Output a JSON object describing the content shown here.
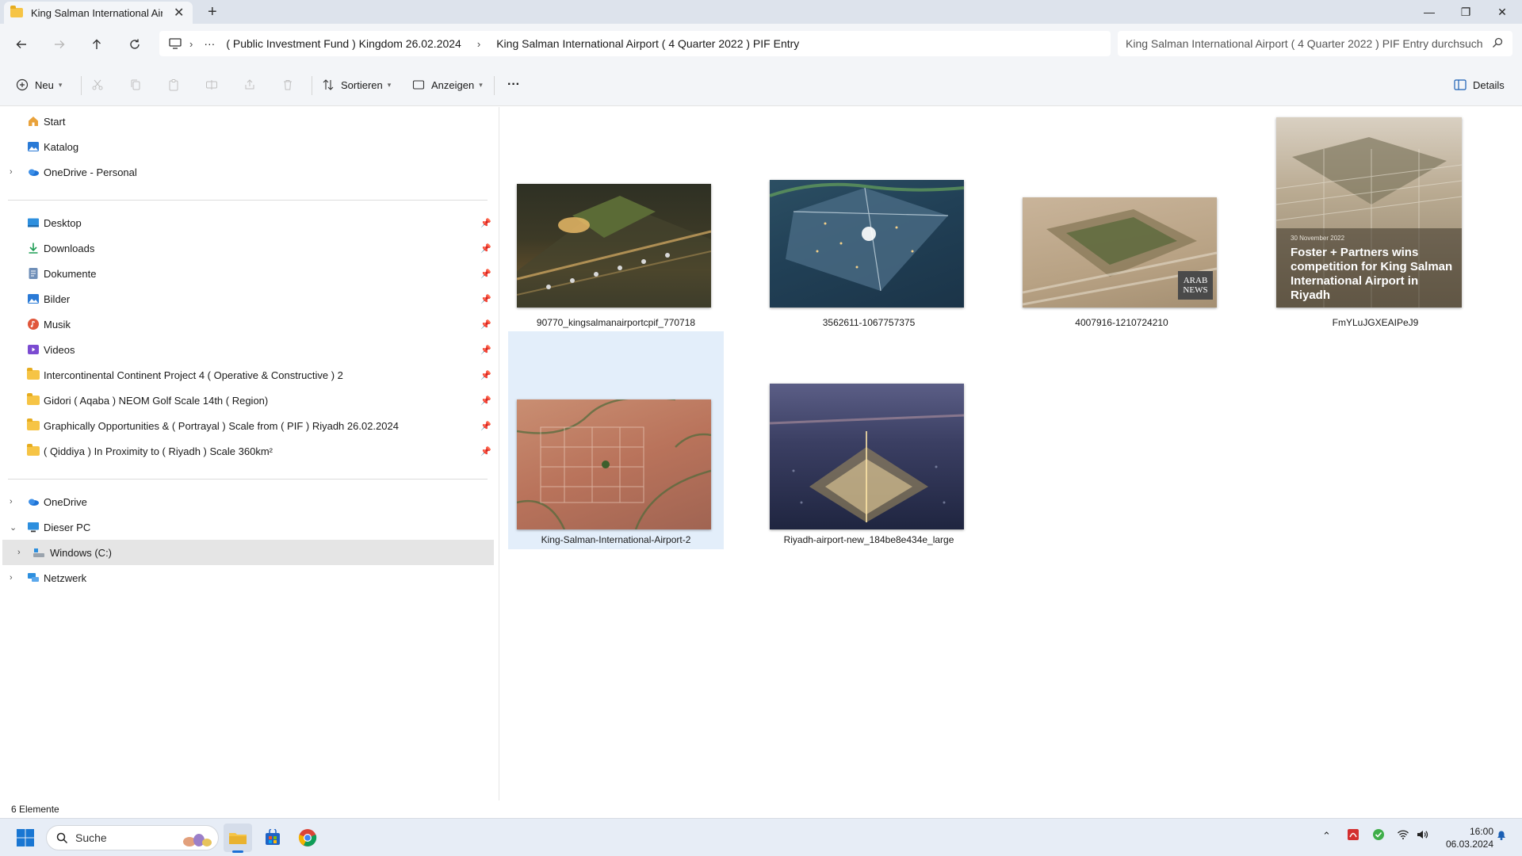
{
  "window": {
    "tab_title": "King Salman International Airp",
    "new_tab_label": "+",
    "minimize": "—",
    "maximize": "❐",
    "close": "✕"
  },
  "address": {
    "more": "···",
    "crumbs": [
      "( Public Investment Fund ) Kingdom 26.02.2024",
      "King Salman International Airport ( 4 Quarter 2022 ) PIF Entry"
    ],
    "search_placeholder": "King Salman International Airport ( 4 Quarter 2022 ) PIF Entry durchsuch"
  },
  "toolbar": {
    "new_label": "Neu",
    "sort_label": "Sortieren",
    "view_label": "Anzeigen",
    "more_label": "···",
    "details_label": "Details"
  },
  "sidebar": {
    "top": [
      {
        "label": "Start",
        "icon": "home-icon"
      },
      {
        "label": "Katalog",
        "icon": "gallery-icon"
      },
      {
        "label": "OneDrive - Personal",
        "icon": "onedrive-icon"
      }
    ],
    "quick": [
      {
        "label": "Desktop",
        "icon": "desktop-icon"
      },
      {
        "label": "Downloads",
        "icon": "downloads-icon"
      },
      {
        "label": "Dokumente",
        "icon": "documents-icon"
      },
      {
        "label": "Bilder",
        "icon": "pictures-icon"
      },
      {
        "label": "Musik",
        "icon": "music-icon"
      },
      {
        "label": "Videos",
        "icon": "videos-icon"
      },
      {
        "label": "Intercontinental Continent Project 4 ( Operative & Constructive ) 2",
        "icon": "folder-icon"
      },
      {
        "label": "Gidori ( Aqaba ) NEOM Golf Scale 14th (  Region)",
        "icon": "folder-icon"
      },
      {
        "label": "Graphically Opportunities & ( Portrayal )  Scale from ( PIF ) Riyadh 26.02.2024",
        "icon": "folder-icon"
      },
      {
        "label": "( Qiddiya ) In Proximity to ( Riyadh ) Scale 360km²",
        "icon": "folder-icon"
      }
    ],
    "bottom": [
      {
        "label": "OneDrive",
        "icon": "onedrive-icon"
      },
      {
        "label": "Dieser PC",
        "icon": "pc-icon"
      },
      {
        "label": "Windows (C:)",
        "icon": "drive-icon"
      },
      {
        "label": "Netzwerk",
        "icon": "network-icon"
      }
    ]
  },
  "files": [
    {
      "name": "90770_kingsalmanairportcpif_770718"
    },
    {
      "name": "3562611-1067757375"
    },
    {
      "name": "4007916-1210724210",
      "badge": "ARAB NEWS"
    },
    {
      "name": "FmYLuJGXEAIPeJ9",
      "overlay_date": "30 November 2022",
      "overlay_text": "Foster + Partners wins competition for King Salman International Airport in Riyadh"
    },
    {
      "name": "King-Salman-International-Airport-2"
    },
    {
      "name": "Riyadh-airport-new_184be8e434e_large"
    }
  ],
  "status": {
    "count": "6 Elemente"
  },
  "taskbar": {
    "search_label": "Suche",
    "time": "16:00",
    "date": "06.03.2024"
  }
}
